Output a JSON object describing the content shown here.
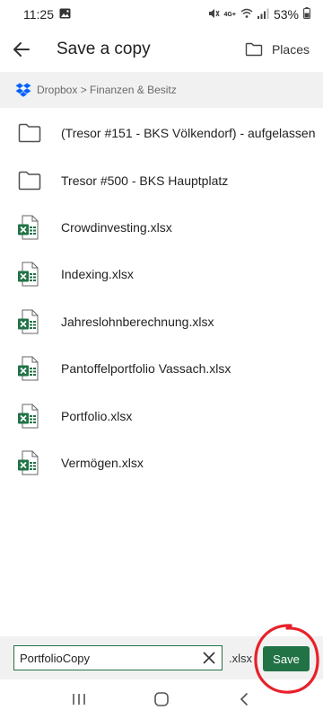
{
  "status": {
    "time": "11:25",
    "network": "4G+",
    "battery": "53%"
  },
  "header": {
    "title": "Save a copy",
    "places_label": "Places"
  },
  "breadcrumb": {
    "path": "Dropbox > Finanzen & Besitz"
  },
  "files": [
    {
      "name": "(Tresor #151 - BKS Völkendorf) - aufgelassen",
      "type": "folder"
    },
    {
      "name": "Tresor #500 - BKS Hauptplatz",
      "type": "folder"
    },
    {
      "name": "Crowdinvesting.xlsx",
      "type": "excel"
    },
    {
      "name": "Indexing.xlsx",
      "type": "excel"
    },
    {
      "name": "Jahreslohnberechnung.xlsx",
      "type": "excel"
    },
    {
      "name": "Pantoffelportfolio Vassach.xlsx",
      "type": "excel"
    },
    {
      "name": "Portfolio.xlsx",
      "type": "excel"
    },
    {
      "name": "Vermögen.xlsx",
      "type": "excel"
    }
  ],
  "footer": {
    "filename_value": "PortfolioCopy",
    "extension": ".xlsx",
    "save_label": "Save"
  },
  "colors": {
    "excel_green": "#217346",
    "dropbox_blue": "#0061fe",
    "annotation_red": "#e8202a",
    "breadcrumb_bg": "#f1f1f1"
  }
}
